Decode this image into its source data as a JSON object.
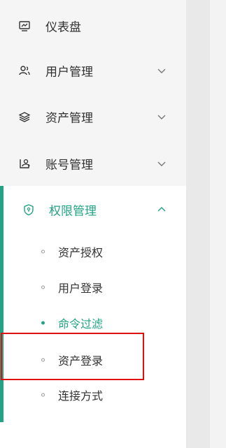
{
  "sidebar": {
    "items": [
      {
        "label": "仪表盘",
        "icon": "dashboard-icon",
        "expandable": false
      },
      {
        "label": "用户管理",
        "icon": "users-icon",
        "expandable": true
      },
      {
        "label": "资产管理",
        "icon": "layers-icon",
        "expandable": true
      },
      {
        "label": "账号管理",
        "icon": "account-icon",
        "expandable": true
      },
      {
        "label": "权限管理",
        "icon": "shield-icon",
        "expandable": true,
        "expanded": true,
        "active": true
      }
    ],
    "submenu": [
      {
        "label": "资产授权"
      },
      {
        "label": "用户登录"
      },
      {
        "label": "命令过滤",
        "active": true
      },
      {
        "label": "资产登录",
        "highlighted": true
      },
      {
        "label": "连接方式"
      }
    ]
  },
  "colors": {
    "accent": "#22a384",
    "highlight_border": "#e01010"
  }
}
